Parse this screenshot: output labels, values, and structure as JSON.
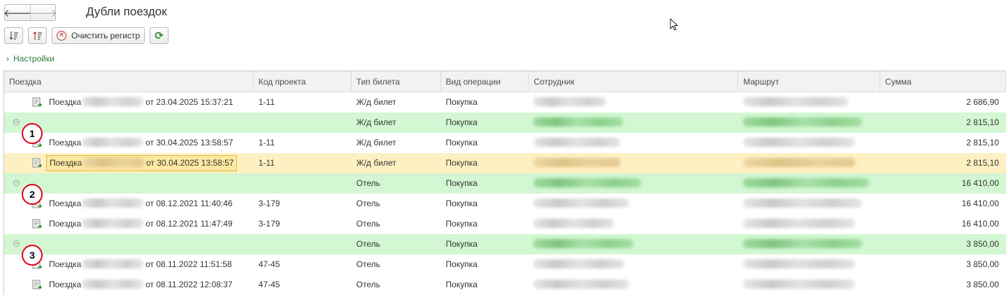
{
  "window": {
    "title": "Дубли поездок"
  },
  "nav": {
    "back_icon": "arrow-left-icon",
    "forward_icon": "arrow-right-icon"
  },
  "toolbar": {
    "clear_register_label": "Очистить регистр"
  },
  "settings": {
    "label": "Настройки"
  },
  "table": {
    "columns": [
      "Поездка",
      "Код проекта",
      "Тип билета",
      "Вид операции",
      "Сотрудник",
      "Маршрут",
      "Сумма"
    ],
    "rows": [
      {
        "type": "item",
        "trip_prefix": "Поездка",
        "trip_date": "от 23.04.2025 15:37:21",
        "project": "1-11",
        "ticket": "Ж/д билет",
        "operation": "Покупка",
        "sum": "2 686,90"
      },
      {
        "type": "group",
        "marker": "1",
        "project": "",
        "ticket": "Ж/д билет",
        "operation": "Покупка",
        "sum": "2 815,10"
      },
      {
        "type": "item",
        "trip_prefix": "Поездка",
        "trip_date": "от 30.04.2025 13:58:57",
        "project": "1-11",
        "ticket": "Ж/д билет",
        "operation": "Покупка",
        "sum": "2 815,10"
      },
      {
        "type": "item",
        "selected": true,
        "trip_prefix": "Поездка",
        "trip_date": "от 30.04.2025 13:58:57",
        "project": "1-11",
        "ticket": "Ж/д билет",
        "operation": "Покупка",
        "sum": "2 815,10"
      },
      {
        "type": "group",
        "marker": "2",
        "project": "",
        "ticket": "Отель",
        "operation": "Покупка",
        "sum": "16 410,00"
      },
      {
        "type": "item",
        "trip_prefix": "Поездка",
        "trip_date": "от 08.12.2021 11:40:46",
        "project": "3-179",
        "ticket": "Отель",
        "operation": "Покупка",
        "sum": "16 410,00"
      },
      {
        "type": "item",
        "trip_prefix": "Поездка",
        "trip_date": "от 08.12.2021 11:47:49",
        "project": "3-179",
        "ticket": "Отель",
        "operation": "Покупка",
        "sum": "16 410,00"
      },
      {
        "type": "group",
        "marker": "3",
        "project": "",
        "ticket": "Отель",
        "operation": "Покупка",
        "sum": "3 850,00"
      },
      {
        "type": "item",
        "trip_prefix": "Поездка",
        "trip_date": "от 08.11.2022 11:51:58",
        "project": "47-45",
        "ticket": "Отель",
        "operation": "Покупка",
        "sum": "3 850,00"
      },
      {
        "type": "item",
        "trip_prefix": "Поездка",
        "trip_date": "от 08.11.2022 12:08:37",
        "project": "47-45",
        "ticket": "Отель",
        "operation": "Покупка",
        "sum": "3 850,00"
      }
    ]
  },
  "colors": {
    "group_row": "#d2f7d2",
    "selected_row": "#fdf0c2",
    "marker_border": "#e0001a",
    "settings_link": "#2c7d3c"
  }
}
